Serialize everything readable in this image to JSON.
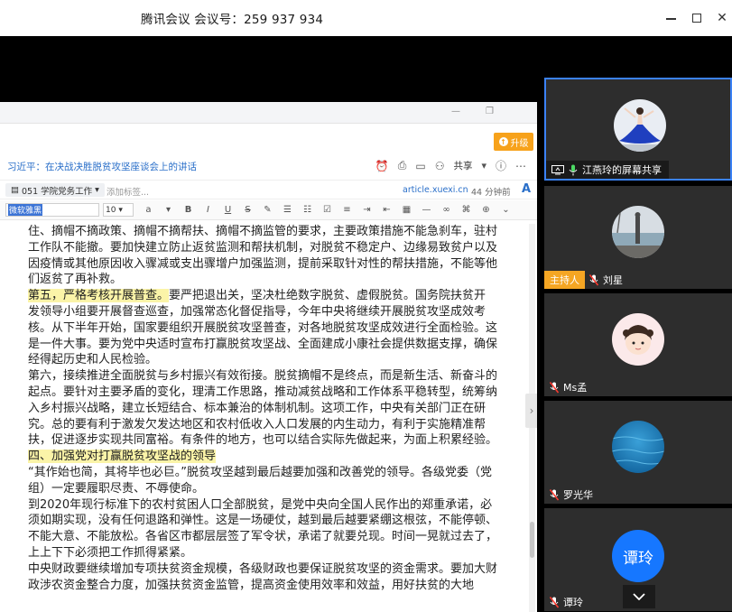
{
  "window": {
    "title": "腾讯会议  会议号：259 937 934"
  },
  "document": {
    "upgrade_label": "升级",
    "article_title": "习近平：在决战决胜脱贫攻坚座谈会上的讲话",
    "share_label": "共享",
    "notebook_label": "051 学院党务工作",
    "tags_placeholder": "添加标签...",
    "source_link": "article.xuexi.cn",
    "word_count": "44 分钟前",
    "font_name": "微软雅黑",
    "font_size": "10",
    "paragraphs": [
      {
        "text": "住、摘帽不摘政策、摘帽不摘帮扶、摘帽不摘监管的要求，主要政策措施不能急刹车，驻村工作队不能撤。要加快建立防止返贫监测和帮扶机制，对脱贫不稳定户、边缘易致贫户以及因疫情或其他原因收入骤减或支出骤增户加强监测，提前采取针对性的帮扶措施，不能等他们返贫了再补救。"
      },
      {
        "highlight": "第五，严格考核开展普查。",
        "text": "要严把退出关，坚决杜绝数字脱贫、虚假脱贫。国务院扶贫开发领导小组要开展督查巡查，加强常态化督促指导，今年中央将继续开展脱贫攻坚成效考核。从下半年开始，国家要组织开展脱贫攻坚普查，对各地脱贫攻坚成效进行全面检验。这是一件大事。要为党中央适时宣布打赢脱贫攻坚战、全面建成小康社会提供数据支撑，确保经得起历史和人民检验。"
      },
      {
        "text": "第六，接续推进全面脱贫与乡村振兴有效衔接。脱贫摘帽不是终点，而是新生活、新奋斗的起点。要针对主要矛盾的变化，理清工作思路，推动减贫战略和工作体系平稳转型，统筹纳入乡村振兴战略，建立长短结合、标本兼治的体制机制。这项工作，中央有关部门正在研究。总的要有利于激发欠发达地区和农村低收入人口发展的内生动力，有利于实施精准帮扶，促进逐步实现共同富裕。有条件的地方，也可以结合实际先做起来，为面上积累经验。"
      },
      {
        "highlight": "四、加强党对打赢脱贫攻坚战的领导",
        "text": ""
      },
      {
        "text": "“其作始也简，其将毕也必巨。”脱贫攻坚越到最后越要加强和改善党的领导。各级党委（党组）一定要履职尽责、不辱使命。"
      },
      {
        "text": "到2020年现行标准下的农村贫困人口全部脱贫，是党中央向全国人民作出的郑重承诺，必须如期实现，没有任何退路和弹性。这是一场硬仗，越到最后越要紧绷这根弦，不能停顿、不能大意、不能放松。各省区市都层层签了军令状，承诺了就要兑现。时间一晃就过去了，上上下下必须把工作抓得紧紧。"
      },
      {
        "text": "中央财政要继续增加专项扶贫资金规模，各级财政也要保证脱贫攻坚的资金需求。要加大财政涉农资金整合力度，加强扶贫资金监管，提高资金使用效率和效益，用好扶贫的大地"
      }
    ]
  },
  "participants": [
    {
      "name": "江燕玲的屏幕共享",
      "role": "",
      "avatar_type": "photo",
      "avatar_icon": "dancer-avatar"
    },
    {
      "name": "刘星",
      "role": "主持人",
      "avatar_type": "photo",
      "avatar_icon": "lakeside-avatar"
    },
    {
      "name": "Ms孟",
      "role": "",
      "avatar_type": "photo",
      "avatar_icon": "cartoon-girl-avatar"
    },
    {
      "name": "罗光华",
      "role": "",
      "avatar_type": "photo",
      "avatar_icon": "ocean-avatar"
    },
    {
      "name": "谭玲",
      "role": "",
      "avatar_type": "initials",
      "initials": "谭玲"
    }
  ],
  "colors": {
    "accent": "#1677ff",
    "host_badge": "#f5a623",
    "highlight": "#fbf4a8",
    "share_border": "#3b82f6"
  }
}
